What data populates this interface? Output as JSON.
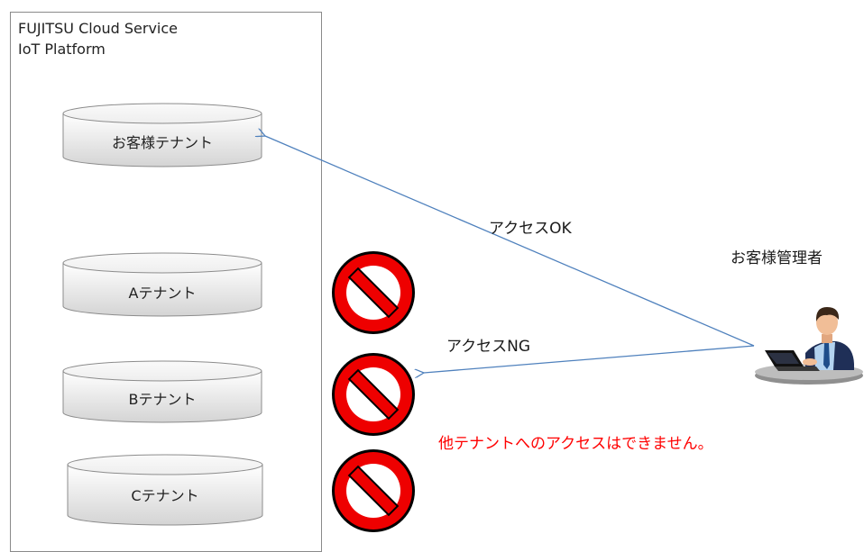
{
  "platform": {
    "title_line1": "FUJITSU  Cloud Service",
    "title_line2": "IoT Platform"
  },
  "tenants": [
    {
      "label": "お客様テナント",
      "access": "ok"
    },
    {
      "label": "Aテナント",
      "access": "ng"
    },
    {
      "label": "Bテナント",
      "access": "ng"
    },
    {
      "label": "Cテナント",
      "access": "ng"
    }
  ],
  "arrows": {
    "ok_label": "アクセスOK",
    "ng_label": "アクセスNG"
  },
  "admin": {
    "label": "お客様管理者"
  },
  "warning": {
    "text": "他テナントへのアクセスはできません。",
    "color": "#ff0000"
  },
  "colors": {
    "arrow": "#4f81bd",
    "prohibit_red": "#ee0000",
    "cylinder_border": "#8c8c8c"
  }
}
